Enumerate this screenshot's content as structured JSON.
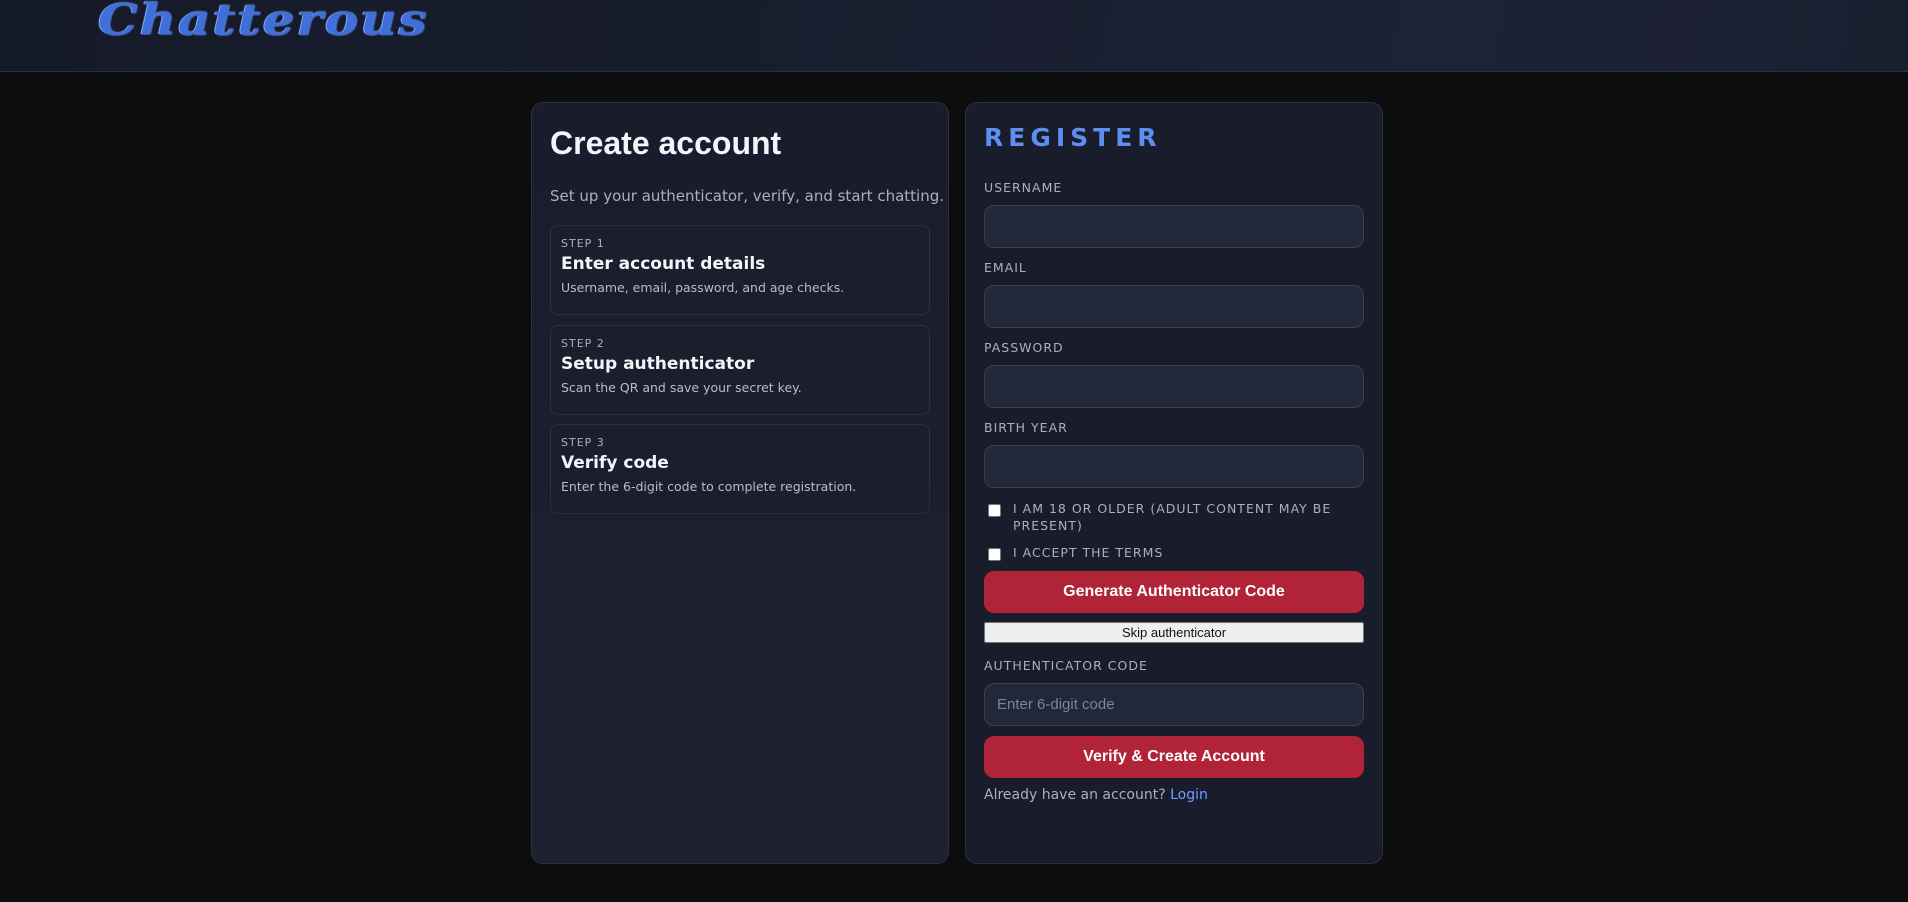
{
  "header": {
    "logo_text": "Chatterous"
  },
  "intro": {
    "title": "Create account",
    "subtitle": "Set up your authenticator, verify, and start chatting.",
    "steps": [
      {
        "label": "STEP 1",
        "title": "Enter account details",
        "desc": "Username, email, password, and age checks."
      },
      {
        "label": "STEP 2",
        "title": "Setup authenticator",
        "desc": "Scan the QR and save your secret key."
      },
      {
        "label": "STEP 3",
        "title": "Verify code",
        "desc": "Enter the 6-digit code to complete registration."
      }
    ]
  },
  "register": {
    "title": "REGISTER",
    "username_label": "USERNAME",
    "username_value": "",
    "email_label": "EMAIL",
    "email_value": "",
    "password_label": "PASSWORD",
    "password_value": "",
    "birth_year_label": "BIRTH YEAR",
    "birth_year_value": "",
    "adult_check_label": "I AM 18 OR OLDER (ADULT CONTENT MAY BE PRESENT)",
    "adult_checked": false,
    "terms_check_label": "I ACCEPT THE TERMS",
    "terms_checked": false,
    "generate_button": "Generate Authenticator Code",
    "skip_button": "Skip authenticator",
    "auth_code_label": "AUTHENTICATOR CODE",
    "auth_code_placeholder": "Enter 6-digit code",
    "verify_button": "Verify & Create Account",
    "login_prompt": "Already have an account?",
    "login_link": "Login"
  },
  "colors": {
    "accent_blue": "#5d8ef0",
    "button_red": "#b12336",
    "link_blue": "#6ea0ff",
    "panel_bg": "#181c2b",
    "page_bg": "#0d0d0e"
  }
}
